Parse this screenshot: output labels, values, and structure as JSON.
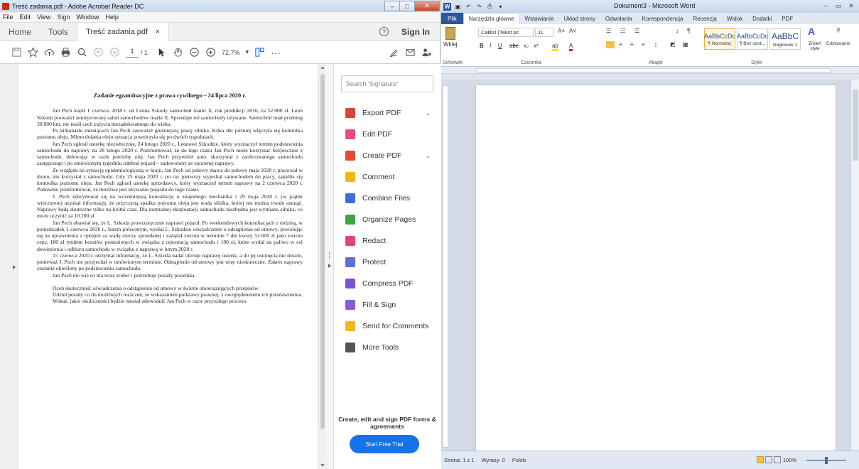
{
  "acrobat": {
    "window_title": "Treść zadania.pdf - Adobe Acrobat Reader DC",
    "menu": [
      "File",
      "Edit",
      "View",
      "Sign",
      "Window",
      "Help"
    ],
    "tabs": {
      "home": "Home",
      "tools": "Tools",
      "file": "Treść zadania.pdf",
      "file_close": "×"
    },
    "sign_in": "Sign In",
    "help": "?",
    "toolbar": {
      "page_current": "1",
      "page_total": "/ 1",
      "zoom": "72,7%",
      "zoom_caret": "▾",
      "more": "···"
    },
    "document": {
      "title": "Zadanie egzaminacyjne z prawa cywilnego – 24 lipca 2020 r.",
      "paragraphs": [
        "Jan Pech kupił 1 czerwca 2018 r. od Leona Szkody samochód marki X, rok produkcji 2016, za 52.000 zł. Leon Szkoda prowadzi autoryzowany salon samochodów marki X. Sprzedaje też samochody używane. Samochód miał przebieg 30.000 km, nie nosił cech zużycia niezadekwatnego do wieku.",
        "Po kilkunastu miesiącach Jan Pech zauważył głośniejszą pracę silnika. Kilka dni później włączyła się kontrolka poziomu oleju. Mimo dolania oleju sytuacja powtórzyła się po dwóch tygodniach.",
        "Jan Pech zgłosił usterkę niezwłocznie, 24 lutego 2020 r., Leonowi Szkodzie, który wyznaczył termin podstawienia samochodu do naprawy na 28 lutego 2020 r. Poinformował, że do tego czasu Jan Pech może korzystać bezpiecznie z samochodu, dolewając w razie potrzeby olej. Jan Pech przywiózł auto, skorzystał z zaoferowanego samochodu zastępczego i po umówionym tygodniu odebrał pojazd – zadowolony ze sprawnej naprawy.",
        "Ze względu na sytuację epidemiologiczną w kraju, Jan Pech od połowy marca do połowy maja 2020 r. pracował w domu, nie korzystał z samochodu. Gdy 25 maja 2020 r. po raz pierwszy wyjechał samochodem do pracy, zapaliła się kontrolka poziomu oleju. Jan Pech zgłosił usterkę sprzedawcy, który wyznaczył termin naprawy na 2 czerwca 2020 r. Ponownie poinformował, że możliwe jest używanie pojazdu do tego czasu.",
        "J. Pech zdecydował się na wcześniejszą konsultację u znajomego mechanika i 29 maja 2020 r. (w piątek wieczorem) uzyskał informację, że przyczyną spadku poziomu oleju jest wada silnika, której nie można trwale usunąć. Naprawy będą skuteczne tylko na krótki czas. Dla normalnej eksploatacji samochodu niezbędna jest wymiana silnika, co może uczynić za 10.200 zł.",
        "Jan Pech obawiał się, że L. Szkoda prowizorycznie naprawi pojazd. Po weekendowych konsultacjach z rodziną, w poniedziałek 1 czerwca 2020 r., listem poleconym, wysłał L. Szkodzie oświadczenie o odstąpieniu od umowy, powołując się na uprawnienia z rękojmi za wadę rzeczy sprzedanej i zażądał zwrotu w terminie 7 dni kwoty 52.000 zł jako zwrotu ceny, 180 zł tytułem kosztów poniesionych w związku z rejestracją samochodu i 100 zł, które wydał na paliwo w cel dowiezienia i odbioru samochodu w związku z naprawą w lutym 2020 r.",
        "15 czerwca 2020 r. otrzymał informację, że L. Szkoda nadal oferuje naprawę usterki, a do jej usunięcia nie doszło, ponieważ J. Pech nie przyjechał w umówionym terminie. Odstąpienie od umowy jest więc nieskuteczne. Zakres naprawy zostanie określony po podstawieniu samochodu.",
        "Jan Pech nie wie co ma teraz zrobić i potrzebuje porady prawnika."
      ],
      "tasks": [
        "Oceń skuteczność oświadczenia o odstąpieniu od umowy w świetle obowiązujących przepisów.",
        "Udziel porady co do możliwych roszczeń, ze wskazaniem podstawy prawnej, z uwzględnieniem ich przedawnienia.",
        "Wskaż, jakie okoliczności będzie musiał udowodnić Jan Pech w razie przyszłego procesu."
      ]
    },
    "tools_pane": {
      "search_placeholder": "Search 'Signature'",
      "items": [
        {
          "label": "Export PDF",
          "icon": "export-pdf-icon",
          "color": "#d9453a",
          "chevron": "⌄"
        },
        {
          "label": "Edit PDF",
          "icon": "edit-pdf-icon",
          "color": "#e94b7c"
        },
        {
          "label": "Create PDF",
          "icon": "create-pdf-icon",
          "color": "#e2483a",
          "chevron": "⌄"
        },
        {
          "label": "Comment",
          "icon": "comment-icon",
          "color": "#f2b71b"
        },
        {
          "label": "Combine Files",
          "icon": "combine-files-icon",
          "color": "#3d6fd8"
        },
        {
          "label": "Organize Pages",
          "icon": "organize-pages-icon",
          "color": "#3fa646"
        },
        {
          "label": "Redact",
          "icon": "redact-icon",
          "color": "#e0447a"
        },
        {
          "label": "Protect",
          "icon": "protect-icon",
          "color": "#5f6fd6"
        },
        {
          "label": "Compress PDF",
          "icon": "compress-pdf-icon",
          "color": "#7a52d6"
        },
        {
          "label": "Fill & Sign",
          "icon": "fill-sign-icon",
          "color": "#8a5bd9"
        },
        {
          "label": "Send for Comments",
          "icon": "send-for-comments-icon",
          "color": "#f2b71b"
        },
        {
          "label": "More Tools",
          "icon": "more-tools-icon",
          "color": "#555555"
        }
      ],
      "promo": "Create, edit and sign PDF forms & agreements",
      "cta": "Start Free Trial"
    }
  },
  "word": {
    "window_title": "Dokument3 - Microsoft Word",
    "ribbon_tabs": [
      "Plik",
      "Narzędzia główne",
      "Wstawianie",
      "Układ strony",
      "Odwołania",
      "Korespondencja",
      "Recenzja",
      "Widok",
      "Dodatki",
      "PDF"
    ],
    "active_tab": "Narzędzia główne",
    "ribbon": {
      "paste": "Wklej",
      "clipboard": "Schowek",
      "font_name": "Calibri (Tekst pc",
      "font_size": "11",
      "font_group": "Czcionka",
      "paragraph_group": "Akapit",
      "styles_group": "Style",
      "styles": [
        {
          "sample": "AaBbCcDc",
          "label": "¶ Normalny"
        },
        {
          "sample": "AaBbCcDc",
          "label": "¶ Bez odst..."
        },
        {
          "sample": "AaBbC",
          "label": "Nagłówek 1"
        }
      ],
      "change_styles": "Zmień style",
      "editing": "Edytowanie"
    },
    "status": {
      "page": "Strona: 1 z 1",
      "words": "Wyrazy: 0",
      "language": "Polski",
      "zoom": "100%"
    }
  }
}
